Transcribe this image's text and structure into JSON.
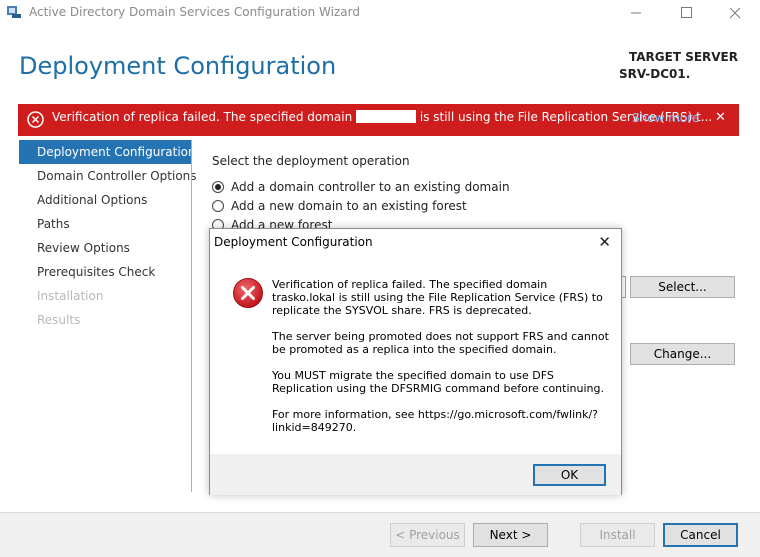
{
  "window": {
    "title": "Active Directory Domain Services Configuration Wizard",
    "minimize": "—",
    "maximize": "☐",
    "close": "✕"
  },
  "header": {
    "page_title": "Deployment Configuration",
    "target_label": "TARGET SERVER",
    "target_server": "SRV-DC01."
  },
  "banner": {
    "text_before": "Verification of replica failed. The specified domain ",
    "text_after": " is still using the File Replication Service (FRS) t...",
    "show_more": "Show more",
    "close": "✕",
    "color": "#cf1d1d"
  },
  "sidebar": {
    "items": [
      {
        "label": "Deployment Configuration"
      },
      {
        "label": "Domain Controller Options"
      },
      {
        "label": "Additional Options"
      },
      {
        "label": "Paths"
      },
      {
        "label": "Review Options"
      },
      {
        "label": "Prerequisites Check"
      },
      {
        "label": "Installation"
      },
      {
        "label": "Results"
      }
    ]
  },
  "main": {
    "heading": "Select the deployment operation",
    "options": [
      {
        "label": "Add a domain controller to an existing domain",
        "checked": true
      },
      {
        "label": "Add a new domain to an existing forest",
        "checked": false
      },
      {
        "label": "Add a new forest",
        "checked": false
      }
    ],
    "select_button": "Select...",
    "change_button": "Change..."
  },
  "footer": {
    "previous": "< Previous",
    "next": "Next >",
    "install": "Install",
    "cancel": "Cancel"
  },
  "dialog": {
    "title": "Deployment Configuration",
    "close": "✕",
    "paragraphs": [
      "Verification of replica failed. The specified domain trasko.lokal is still using the File Replication Service (FRS) to replicate the SYSVOL share. FRS is deprecated.",
      "The server being promoted does not support FRS and cannot be promoted as a replica into the specified domain.",
      "You MUST migrate the specified domain to use DFS Replication using the DFSRMIG command before continuing.",
      "For more information, see https://go.microsoft.com/fwlink/?linkid=849270."
    ],
    "ok": "OK",
    "error_icon_color": "#d21f26"
  }
}
